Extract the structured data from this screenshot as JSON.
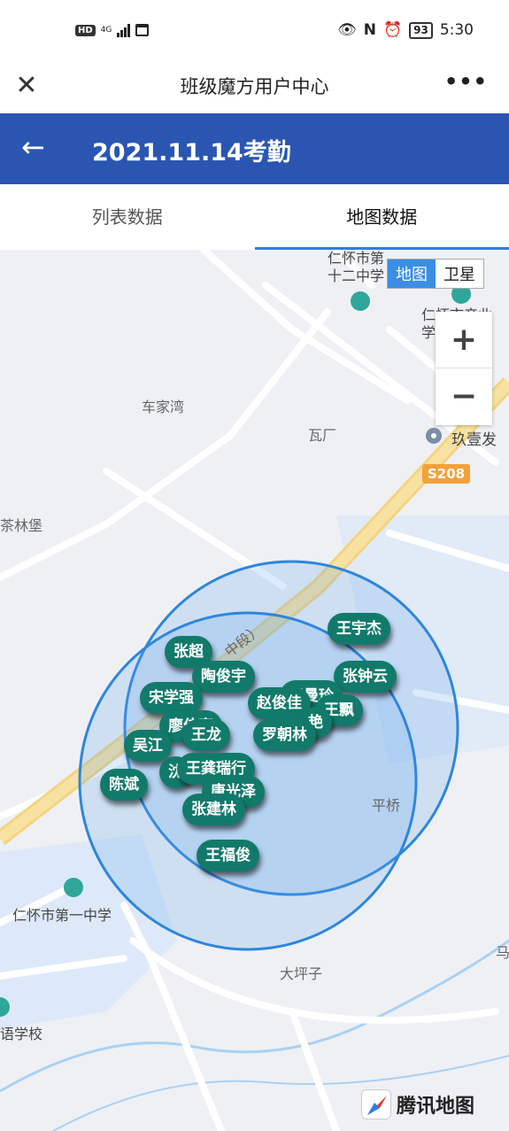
{
  "status_bar": {
    "left_badge": "HD",
    "signal": "4G",
    "time": "5:30",
    "battery": "93"
  },
  "titlebar": {
    "title": "班级魔方用户中心",
    "close_icon": "close-icon",
    "more": "•••"
  },
  "header": {
    "title": "2021.11.14考勤",
    "back_icon": "arrow-left-icon"
  },
  "tabs": [
    {
      "label": "列表数据",
      "active": false
    },
    {
      "label": "地图数据",
      "active": true
    }
  ],
  "map": {
    "map_type": {
      "map_label": "地图",
      "satellite_label": "卫星",
      "selected": "地图"
    },
    "zoom": {
      "in": "+",
      "out": "−"
    },
    "road_badge": "S208",
    "places": {
      "school12": "仁怀市第\n十二中学",
      "top_right": "仁怀市产业\n学校",
      "chejiawan": "车家湾",
      "wachang": "瓦厂",
      "jiuyi": "玖壹发",
      "chalinbao": "茶林堡",
      "pingqiao": "平桥",
      "school1": "仁怀市第一中学",
      "dapingzi": "大坪子",
      "yuyan": "语学校",
      "ma": "马",
      "zhongduan": "中段）"
    },
    "markers": [
      "王宇杰",
      "张超",
      "陶俊宇",
      "张钟云",
      "宋学强",
      "王曼玲",
      "赵俊佳",
      "廖佳亮",
      "王龙",
      "罗朝林",
      "吴江",
      "沈",
      "王龚瑞行",
      "陈斌",
      "唐光泽",
      "张建林",
      "王福俊",
      "王飘",
      "艳"
    ],
    "logo_text": "腾讯地图"
  }
}
